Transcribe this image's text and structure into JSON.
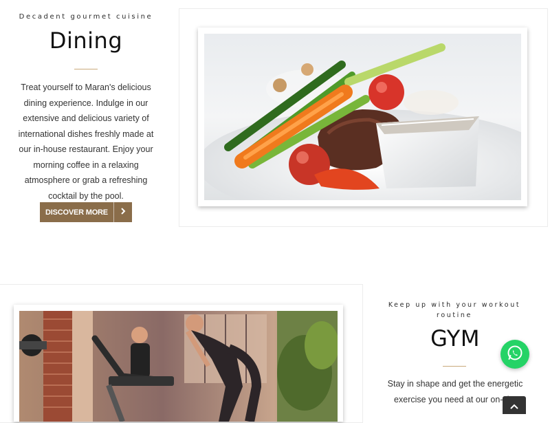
{
  "dining": {
    "kicker": "Decadent gourmet cuisine",
    "title": "Dining",
    "body": "Treat yourself to Maran's delicious dining experience. Indulge in our extensive and delicious variety of international dishes freshly made at our in-house restaurant. Enjoy your morning coffee in a relaxing atmosphere or grab a refreshing cocktail by the pool.",
    "button_label": "DISCOVER MORE",
    "button_icon": "chevron-right-icon",
    "accent_color": "#8a6d4a"
  },
  "gym": {
    "kicker_line1": "Keep up with your workout",
    "kicker_line2": "routine",
    "title": "GYM",
    "body_line1": "Stay in shape and get the energetic",
    "body_line2": "exercise you need at our on-site"
  },
  "floating": {
    "whatsapp_icon": "whatsapp-icon",
    "whatsapp_color": "#25d366",
    "scroll_top_icon": "chevron-up-icon"
  }
}
